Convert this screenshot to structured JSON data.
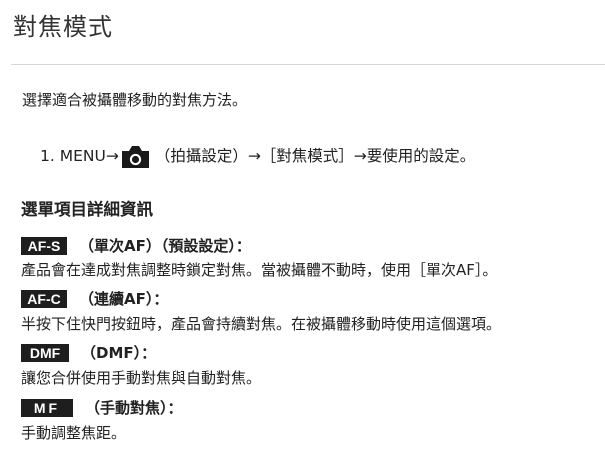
{
  "page": {
    "title": "對焦模式",
    "intro": "選擇適合被攝體移動的對焦方法。",
    "step": {
      "prefix": "1. MENU→",
      "icon": "camera-icon",
      "suffix": "（拍攝設定）→［對焦模式］→要使用的設定。"
    },
    "section_heading": "選單項目詳細資訊",
    "modes": [
      {
        "badge": "AF-S",
        "label": "（單次AF）（預設設定）：",
        "description": "產品會在達成對焦調整時鎖定對焦。當被攝體不動時，使用［單次AF］。"
      },
      {
        "badge": "AF-C",
        "label": "（連續AF）：",
        "description": "半按下住快門按鈕時，產品會持續對焦。在被攝體移動時使用這個選項。"
      },
      {
        "badge": "DMF",
        "label": "（DMF）：",
        "description": "讓您合併使用手動對焦與自動對焦。"
      },
      {
        "badge": "MF",
        "label": "（手動對焦）：",
        "description": "手動調整焦距。"
      }
    ]
  }
}
